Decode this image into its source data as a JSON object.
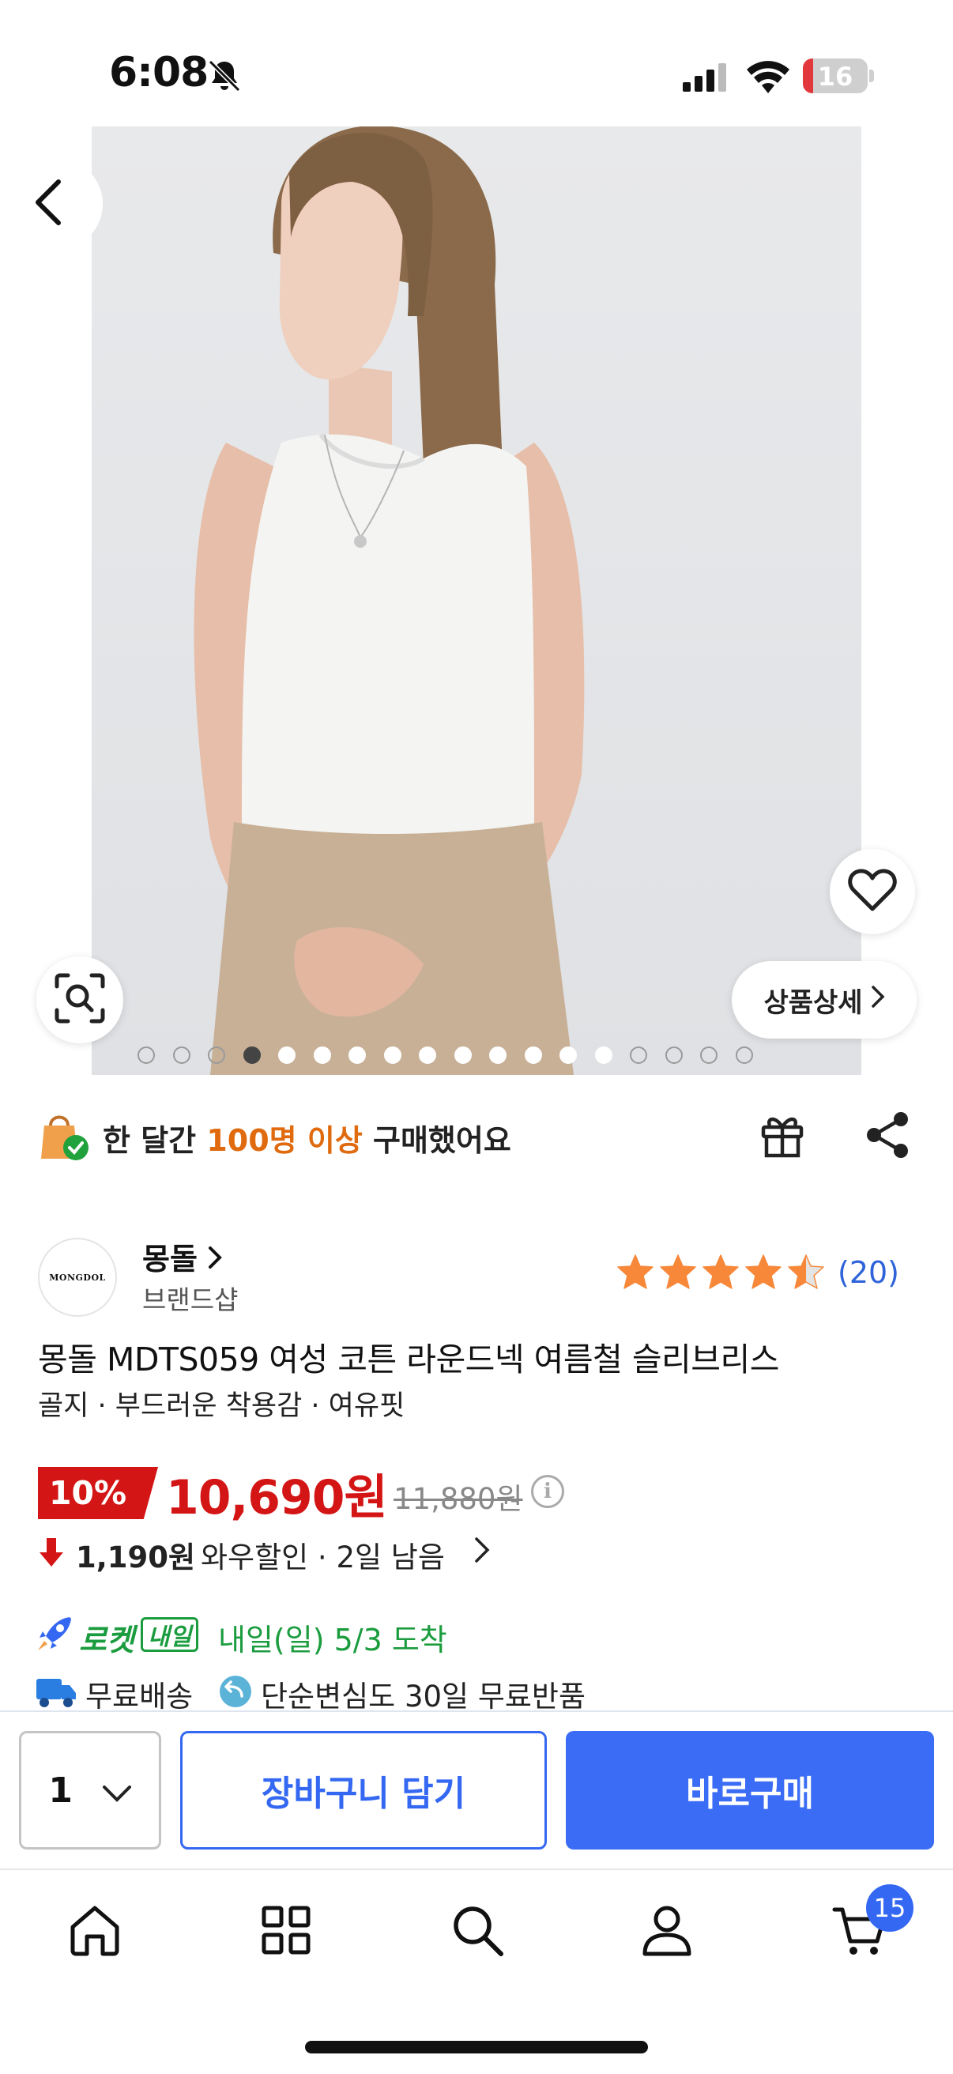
{
  "status_bar": {
    "time": "6:08",
    "battery": "16"
  },
  "product": {
    "detail_button": "상품상세",
    "image_index": 4,
    "image_count": 18
  },
  "social_proof": {
    "prefix": "한 달간 ",
    "highlight": "100명 이상",
    "suffix": " 구매했어요"
  },
  "brand": {
    "logo_text": "MONGDOL",
    "name": "몽돌",
    "subtitle": "브랜드샵",
    "rating": 4.5,
    "review_count": "(20)"
  },
  "title": "몽돌 MDTS059 여성 코튼 라운드넥 여름철 슬리브리스",
  "subtitle": "골지 · 부드러운 착용감 · 여유핏",
  "price": {
    "discount": "10%",
    "sale": "10,690원",
    "original": "11,880원",
    "info": "i",
    "wow_amount": "1,190원",
    "wow_text": "와우할인 · 2일 남음"
  },
  "delivery": {
    "rocket": "로켓",
    "tomorrow": "내일",
    "arrival": "내일(일) 5/3 도착",
    "free_shipping": "무료배송",
    "free_return": "단순변심도 30일 무료반품"
  },
  "buy_bar": {
    "quantity": "1",
    "add_to_cart": "장바구니 담기",
    "buy_now": "바로구매"
  },
  "tabbar": {
    "cart_count": "15"
  },
  "colors": {
    "accent_blue": "#3468f2",
    "sale_red": "#d41515",
    "rocket_green": "#1b9c3e",
    "highlight_orange": "#e06a0e",
    "star_orange": "#f7883a"
  },
  "icons": [
    "back-icon",
    "heart-icon",
    "image-search-icon",
    "chevron-right-icon",
    "shopping-bag-icon",
    "gift-icon",
    "share-icon",
    "star-icon",
    "arrow-down-icon",
    "rocket-icon",
    "truck-icon",
    "return-icon",
    "chevron-down-icon",
    "home-icon",
    "category-icon",
    "search-icon",
    "user-icon",
    "cart-icon"
  ]
}
